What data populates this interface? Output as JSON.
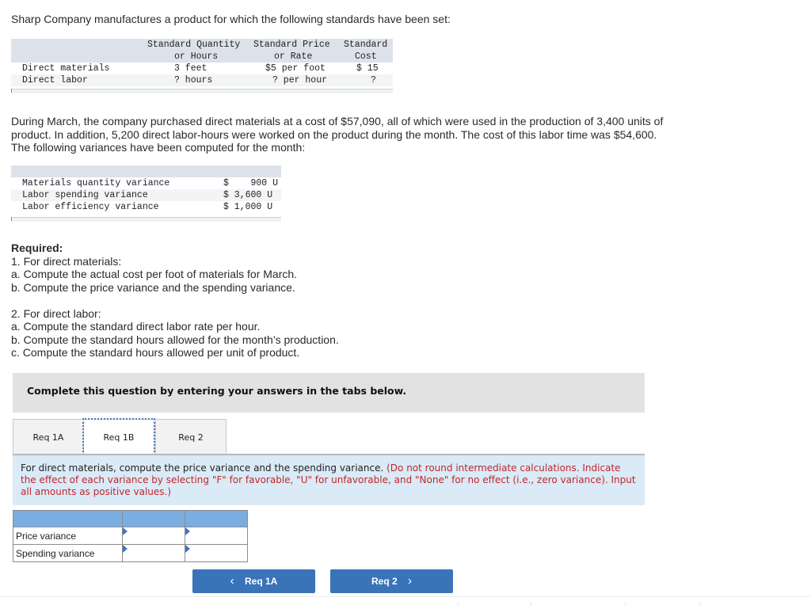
{
  "intro": "Sharp Company manufactures a product for which the following standards have been set:",
  "standards_table": {
    "headers": [
      [
        "",
        ""
      ],
      [
        "Standard Quantity",
        "or Hours"
      ],
      [
        "Standard Price",
        "or Rate"
      ],
      [
        "Standard",
        "Cost"
      ]
    ],
    "rows": [
      {
        "label": "Direct materials",
        "qty": "3 feet",
        "price": "$5 per foot",
        "cost": "$ 15"
      },
      {
        "label": "Direct labor",
        "qty": "? hours",
        "price": "? per hour",
        "cost": "?"
      }
    ]
  },
  "paragraph2": [
    "During March, the company purchased direct materials at a cost of $57,090, all of which were used in the production of 3,400 units of",
    "product. In addition, 5,200 direct labor-hours were worked on the product during the month. The cost of this labor time was $54,600.",
    "The following variances have been computed for the month:"
  ],
  "variance_table": {
    "rows": [
      {
        "label": "Materials quantity variance",
        "value": "$    900 U"
      },
      {
        "label": "Labor spending variance",
        "value": "$ 3,600 U"
      },
      {
        "label": "Labor efficiency variance",
        "value": "$ 1,000 U"
      }
    ]
  },
  "required": {
    "heading": "Required:",
    "lines": [
      "1. For direct materials:",
      "a. Compute the actual cost per foot of materials for March.",
      "b. Compute the price variance and the spending variance.",
      "",
      "2. For direct labor:",
      "a. Compute the standard direct labor rate per hour.",
      "b. Compute the standard hours allowed for the month’s production.",
      "c. Compute the standard hours allowed per unit of product."
    ]
  },
  "banner": "Complete this question by entering your answers in the tabs below.",
  "tabs": [
    {
      "label": "Req 1A",
      "active": false
    },
    {
      "label": "Req 1B",
      "active": true
    },
    {
      "label": "Req 2",
      "active": false
    }
  ],
  "instructions": {
    "main": "For direct materials, compute the price variance and the spending variance.",
    "note": "(Do not round intermediate calculations. Indicate the effect of each variance by selecting \"F\" for favorable, \"U\" for unfavorable, and \"None\" for no effect (i.e., zero variance). Input all amounts as positive values.)"
  },
  "answer_table": {
    "rows": [
      {
        "label": "Price variance",
        "amount": "",
        "effect": ""
      },
      {
        "label": "Spending variance",
        "amount": "",
        "effect": ""
      }
    ]
  },
  "nav": {
    "prev_label": "Req 1A",
    "next_label": "Req 2",
    "prev_icon": "‹",
    "next_icon": "›"
  }
}
